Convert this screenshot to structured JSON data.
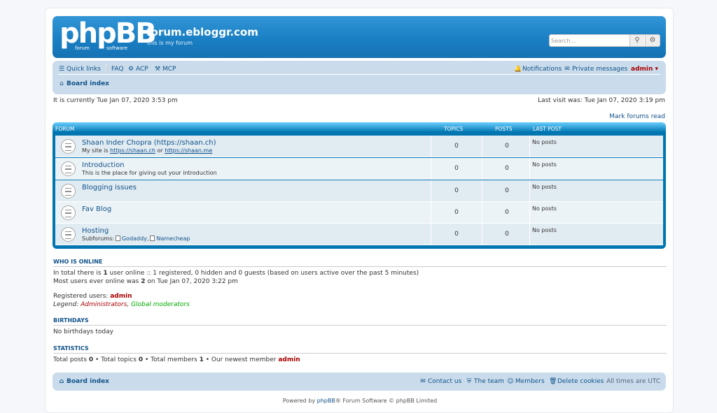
{
  "header": {
    "logo_text": "phpBB",
    "logo_sub1": "forum",
    "logo_sub2": "software",
    "site_title": "forum.ebloggr.com",
    "site_desc": "this is my forum",
    "search_placeholder": "Search…",
    "search_icon": "magnifier-icon",
    "advanced_icon": "gear-icon"
  },
  "navbar": {
    "quick_links": "Quick links",
    "faq": "FAQ",
    "acp": "ACP",
    "mcp": "MCP",
    "notifications": "Notifications",
    "private_messages": "Private messages",
    "user": "admin",
    "breadcrumb": "Board index"
  },
  "meta": {
    "current_time": "It is currently Tue Jan 07, 2020 3:53 pm",
    "last_visit": "Last visit was: Tue Jan 07, 2020 3:19 pm",
    "mark_read": "Mark forums read"
  },
  "forum_table": {
    "headers": {
      "forum": "FORUM",
      "topics": "TOPICS",
      "posts": "POSTS",
      "last_post": "LAST POST"
    },
    "rows": [
      {
        "title": "Shaan Inder Chopra (https://shaan.ch)",
        "desc_prefix": "My site is ",
        "link1": "https://shaan.ch",
        "desc_mid": " or ",
        "link2": "https://shaan.me",
        "topics": "0",
        "posts": "0",
        "last_post": "No posts"
      },
      {
        "title": "Introduction",
        "desc": "This is the place for giving out your introduction",
        "topics": "0",
        "posts": "0",
        "last_post": "No posts"
      },
      {
        "title": "Blogging issues",
        "topics": "0",
        "posts": "0",
        "last_post": "No posts"
      },
      {
        "title": "Fav Blog",
        "topics": "0",
        "posts": "0",
        "last_post": "No posts"
      },
      {
        "title": "Hosting",
        "subforums_label": "Subforums:",
        "subforum1": "Godaddy",
        "subforum2": "Namecheap",
        "topics": "0",
        "posts": "0",
        "last_post": "No posts"
      }
    ]
  },
  "who_online": {
    "heading": "WHO IS ONLINE",
    "line1_a": "In total there is ",
    "line1_b": "1",
    "line1_c": " user online :: 1 registered, 0 hidden and 0 guests (based on users active over the past 5 minutes)",
    "line2_a": "Most users ever online was ",
    "line2_b": "2",
    "line2_c": " on Tue Jan 07, 2020 3:22 pm",
    "registered_label": "Registered users: ",
    "registered_user": "admin",
    "legend_label": "Legend: ",
    "legend_admins": "Administrators",
    "legend_sep": ", ",
    "legend_mods": "Global moderators"
  },
  "birthdays": {
    "heading": "BIRTHDAYS",
    "text": "No birthdays today"
  },
  "statistics": {
    "heading": "STATISTICS",
    "posts_label": "Total posts ",
    "posts": "0",
    "topics_label": " • Total topics ",
    "topics": "0",
    "members_label": " • Total members ",
    "members": "1",
    "newest_label": " • Our newest member ",
    "newest": "admin"
  },
  "footer": {
    "board_index": "Board index",
    "contact": "Contact us",
    "team": "The team",
    "members": "Members",
    "delete_cookies": "Delete cookies",
    "timezone": "All times are UTC",
    "powered_a": "Powered by ",
    "powered_b": "phpBB",
    "powered_c": "® Forum Software © phpBB Limited"
  },
  "colors": {
    "header_blue": "#1a7fc4",
    "nav_bg": "#cadceb",
    "row_bg": "#e1ebf2",
    "admin_red": "#aa0000",
    "mod_green": "#00aa00"
  }
}
